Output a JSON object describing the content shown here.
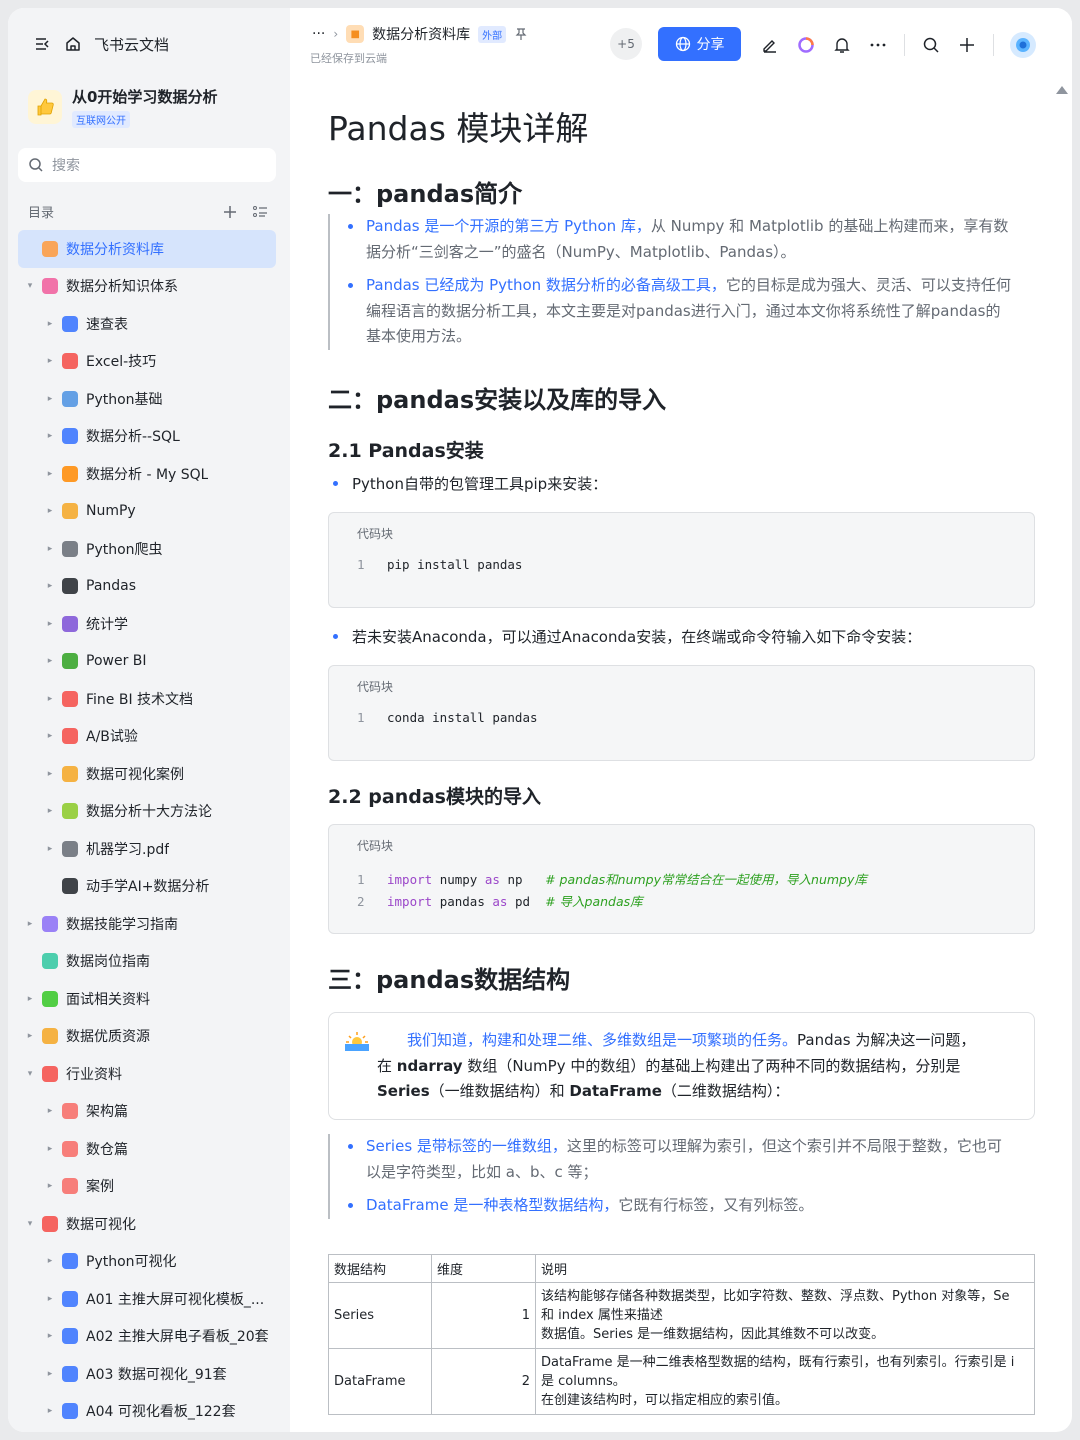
{
  "sidebar": {
    "home_label": "飞书云文档",
    "space_name": "从0开始学习数据分析",
    "space_tag": "互联网公开",
    "search_placeholder": "搜索",
    "toc_label": "目录",
    "items": [
      {
        "label": "数据分析资料库",
        "icon": "folder-orange-icon",
        "color": "#ff9a3c",
        "level": 1,
        "arrow": "",
        "active": true
      },
      {
        "label": "数据分析知识体系",
        "icon": "doc-pink-icon",
        "color": "#f05a9b",
        "level": 1,
        "arrow": "▾",
        "active": false
      },
      {
        "label": "速查表",
        "icon": "magnifier-emoji-icon",
        "color": "#3370ff",
        "level": 2,
        "arrow": "▸",
        "active": false
      },
      {
        "label": "Excel-技巧",
        "icon": "hundred-emoji-icon",
        "color": "#f54a45",
        "level": 2,
        "arrow": "▸",
        "active": false
      },
      {
        "label": "Python基础",
        "icon": "laptop-emoji-icon",
        "color": "#4a90e2",
        "level": 2,
        "arrow": "▸",
        "active": false
      },
      {
        "label": "数据分析--SQL",
        "icon": "bar-chart-emoji-icon",
        "color": "#3370ff",
        "level": 2,
        "arrow": "▸",
        "active": false
      },
      {
        "label": "数据分析 - My SQL",
        "icon": "rainbow-emoji-icon",
        "color": "#ff8800",
        "level": 2,
        "arrow": "▸",
        "active": false
      },
      {
        "label": "NumPy",
        "icon": "memo-emoji-icon",
        "color": "#f5a623",
        "level": 2,
        "arrow": "▸",
        "active": false
      },
      {
        "label": "Python爬虫",
        "icon": "spider-emoji-icon",
        "color": "#646a73",
        "level": 2,
        "arrow": "▸",
        "active": false
      },
      {
        "label": "Pandas",
        "icon": "panda-emoji-icon",
        "color": "#1f2329",
        "level": 2,
        "arrow": "▸",
        "active": false
      },
      {
        "label": "统计学",
        "icon": "floppy-emoji-icon",
        "color": "#7b4fd6",
        "level": 2,
        "arrow": "▸",
        "active": false
      },
      {
        "label": "Power BI",
        "icon": "recycle-emoji-icon",
        "color": "#2ea121",
        "level": 2,
        "arrow": "▸",
        "active": false
      },
      {
        "label": "Fine BI 技术文档",
        "icon": "pushpin-emoji-icon",
        "color": "#f54a45",
        "level": 2,
        "arrow": "▸",
        "active": false
      },
      {
        "label": "A/B试验",
        "icon": "ab-emoji-icon",
        "color": "#f54a45",
        "level": 2,
        "arrow": "▸",
        "active": false
      },
      {
        "label": "数据可视化案例",
        "icon": "medal-emoji-icon",
        "color": "#f5a623",
        "level": 2,
        "arrow": "▸",
        "active": false
      },
      {
        "label": "数据分析十大方法论",
        "icon": "sparkle-emoji-icon",
        "color": "#8ac926",
        "level": 2,
        "arrow": "▸",
        "active": false
      },
      {
        "label": "机器学习.pdf",
        "icon": "robot-emoji-icon",
        "color": "#646a73",
        "level": 2,
        "arrow": "▸",
        "active": false
      },
      {
        "label": "动手学AI+数据分析",
        "icon": "battery-emoji-icon",
        "color": "#1f2329",
        "level": 2,
        "arrow": "",
        "active": false
      },
      {
        "label": "数据技能学习指南",
        "icon": "doc-purple-icon",
        "color": "#8a6cf6",
        "level": 1,
        "arrow": "▸",
        "active": false
      },
      {
        "label": "数据岗位指南",
        "icon": "doc-green-icon",
        "color": "#2ec7a0",
        "level": 1,
        "arrow": "",
        "active": false
      },
      {
        "label": "面试相关资料",
        "icon": "clock-green-icon",
        "color": "#34c724",
        "level": 1,
        "arrow": "▸",
        "active": false
      },
      {
        "label": "数据优质资源",
        "icon": "thumbs-up-emoji-icon",
        "color": "#f5a623",
        "level": 1,
        "arrow": "▸",
        "active": false
      },
      {
        "label": "行业资料",
        "icon": "flower-emoji-icon",
        "color": "#f54a45",
        "level": 1,
        "arrow": "▾",
        "active": false
      },
      {
        "label": "架构篇",
        "icon": "doc-salmon-icon",
        "color": "#f76964",
        "level": 2,
        "arrow": "▸",
        "active": false
      },
      {
        "label": "数仓篇",
        "icon": "doc-salmon-icon",
        "color": "#f76964",
        "level": 2,
        "arrow": "▸",
        "active": false
      },
      {
        "label": "案例",
        "icon": "doc-salmon-icon",
        "color": "#f76964",
        "level": 2,
        "arrow": "▸",
        "active": false
      },
      {
        "label": "数据可视化",
        "icon": "rocket-emoji-icon",
        "color": "#f54a45",
        "level": 1,
        "arrow": "▾",
        "active": false
      },
      {
        "label": "Python可视化",
        "icon": "bar-chart-emoji-icon",
        "color": "#3370ff",
        "level": 2,
        "arrow": "▸",
        "active": false
      },
      {
        "label": "A01 主推大屏可视化模板_...",
        "icon": "bar-chart-emoji-icon",
        "color": "#3370ff",
        "level": 2,
        "arrow": "▸",
        "active": false
      },
      {
        "label": "A02 主推大屏电子看板_20套",
        "icon": "bar-chart-emoji-icon",
        "color": "#3370ff",
        "level": 2,
        "arrow": "▸",
        "active": false
      },
      {
        "label": "A03 数据可视化_91套",
        "icon": "bar-chart-emoji-icon",
        "color": "#3370ff",
        "level": 2,
        "arrow": "▸",
        "active": false
      },
      {
        "label": "A04 可视化看板_122套",
        "icon": "bar-chart-emoji-icon",
        "color": "#3370ff",
        "level": 2,
        "arrow": "▸",
        "active": false
      }
    ]
  },
  "topbar": {
    "more": "···",
    "doc_title": "数据分析资料库",
    "ext_tag": "外部",
    "saved_status": "已经保存到云端",
    "collaborators": "+5",
    "share_label": "分享"
  },
  "doc": {
    "title": "Pandas 模块详解",
    "s1": {
      "heading": "一：pandas简介",
      "b1_blue": "Pandas 是一个开源的第三方 Python 库，",
      "b1_rest_1": "从 Numpy 和 Matplotlib 的基础上构建而来，享有数",
      "b1_rest_2": "据分析“三剑客之一”的盛名（NumPy、Matplotlib、Pandas）。",
      "b2_blue": "Pandas 已经成为 Python 数据分析的必备高级工具，",
      "b2_rest_1": "它的目标是成为强大、灵活、可以支持任何",
      "b2_rest_2": "编程语言的数据分析工具，本文主要是对pandas进行入门，通过本文你将系统性了解pandas的",
      "b2_rest_3": "基本使用方法。"
    },
    "s2": {
      "heading": "二：pandas安装以及库的导入",
      "sub1": "2.1 Pandas安装",
      "bullet1": "Python自带的包管理工具pip来安装：",
      "code_caption": "代码块",
      "code1_line1": "pip install pandas",
      "bullet2": "若未安装Anaconda，可以通过Anaconda安装，在终端或命令符输入如下命令安装：",
      "code2_line1": "conda install pandas",
      "sub2": "2.2 pandas模块的导入",
      "code3_l1_kw1": "import",
      "code3_l1_mod": "numpy",
      "code3_l1_kw2": "as",
      "code3_l1_alias": "np",
      "code3_l1_comment": "# pandas和numpy常常结合在一起使用，导入numpy库",
      "code3_l2_kw1": "import",
      "code3_l2_mod": "pandas",
      "code3_l2_kw2": "as",
      "code3_l2_alias": "pd",
      "code3_l2_comment": "# 导入pandas库"
    },
    "s3": {
      "heading": "三：pandas数据结构",
      "callout_blue": "我们知道，构建和处理二维、多维数组是一项繁琐的任务。",
      "callout_rest_1": "Pandas 为解决这一问题，",
      "callout_line2_a": "在 ",
      "callout_line2_b": "ndarray",
      "callout_line2_c": " 数组（NumPy 中的数组）的基础上构建出了两种不同的数据结构，分别是",
      "callout_line3_a": "Series",
      "callout_line3_b": "（一维数据结构）和 ",
      "callout_line3_c": "DataFrame",
      "callout_line3_d": "（二维数据结构）：",
      "b1_blue": "Series 是带标签的一维数组，",
      "b1_rest_1": "这里的标签可以理解为索引，但这个索引并不局限于整数，它也可",
      "b1_rest_2": "以是字符类型，比如 a、b、c 等；",
      "b2_blue": "DataFrame 是一种表格型数据结构，",
      "b2_rest": "它既有行标签，又有列标签。"
    },
    "table": {
      "headers": [
        "数据结构",
        "维度",
        "说明"
      ],
      "rows": [
        {
          "name": "Series",
          "dim": "1",
          "desc": [
            "该结构能够存储各种数据类型，比如字符数、整数、浮点数、Python 对象等，Se",
            "和 index 属性来描述",
            "数据值。Series 是一维数据结构，因此其维数不可以改变。"
          ]
        },
        {
          "name": "DataFrame",
          "dim": "2",
          "desc": [
            "DataFrame 是一种二维表格型数据的结构，既有行索引，也有列索引。行索引是 i",
            "是 columns。",
            "在创建该结构时，可以指定相应的索引值。"
          ]
        }
      ]
    }
  }
}
